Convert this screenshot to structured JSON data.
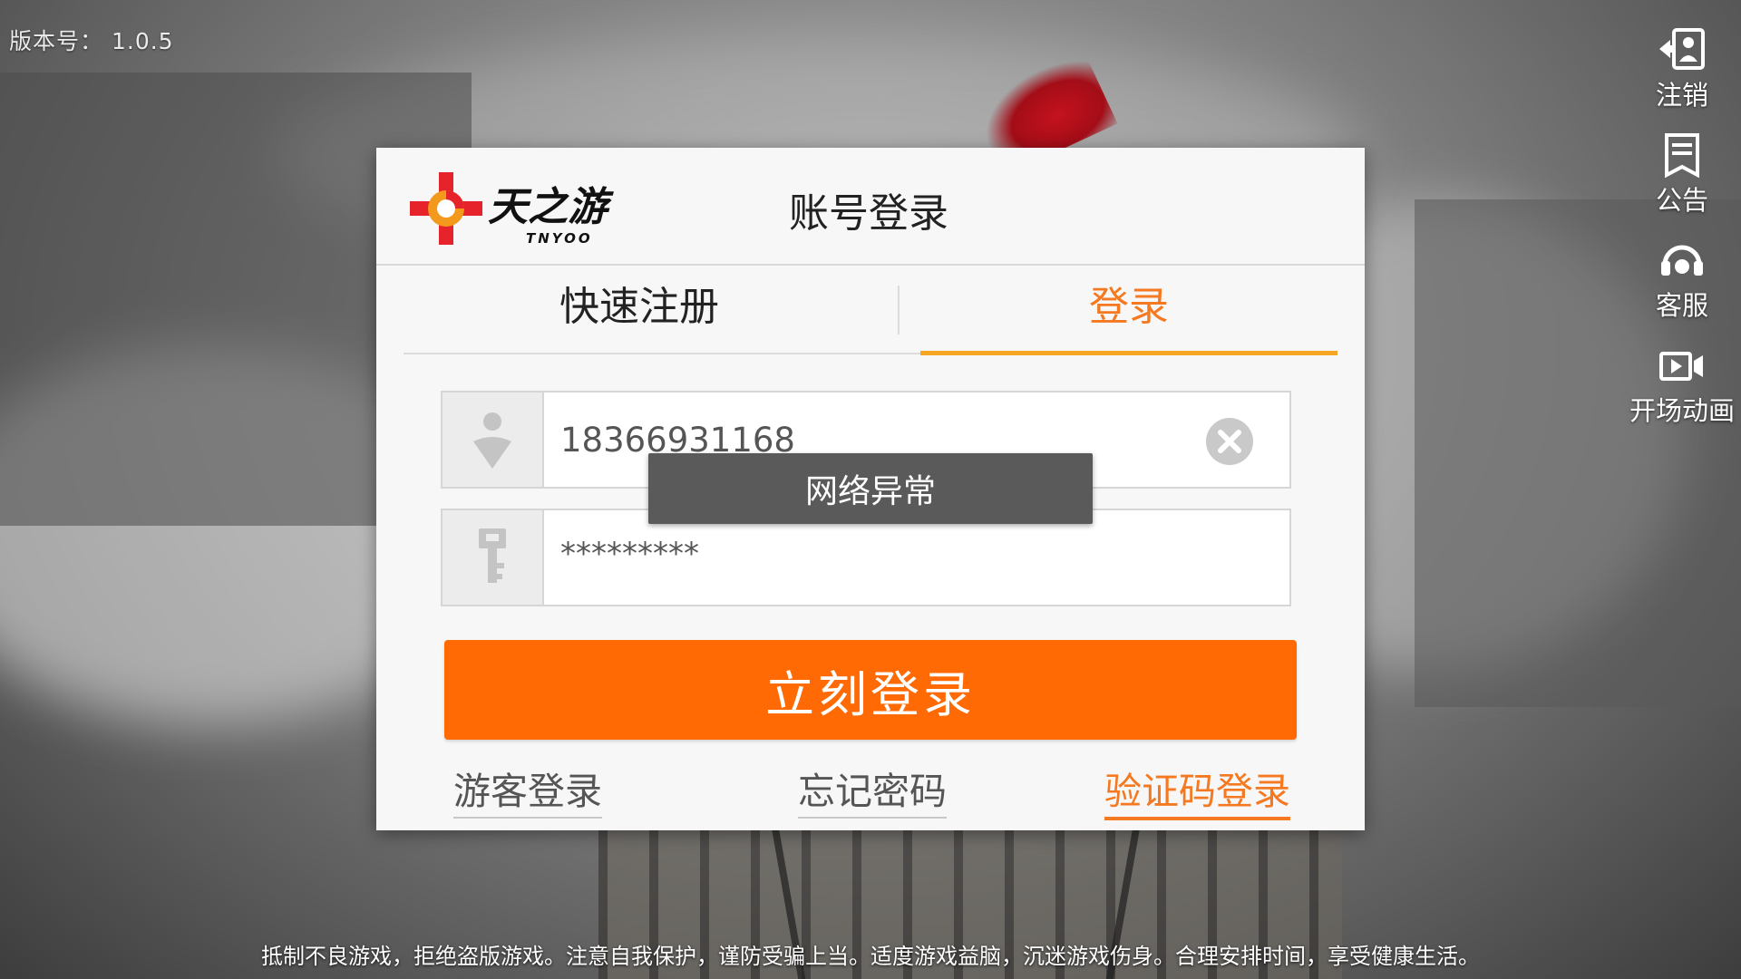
{
  "version": {
    "label": "版本号：",
    "value": "1.0.5"
  },
  "side_menu": [
    {
      "id": "logout",
      "label": "注销",
      "icon": "logout-icon"
    },
    {
      "id": "notice",
      "label": "公告",
      "icon": "notice-icon"
    },
    {
      "id": "service",
      "label": "客服",
      "icon": "headset-icon"
    },
    {
      "id": "intro",
      "label": "开场动画",
      "icon": "video-icon"
    }
  ],
  "dialog": {
    "title": "账号登录",
    "logo": {
      "cn": "天之游",
      "en": "TNYOO"
    },
    "tabs": {
      "register": "快速注册",
      "login": "登录",
      "active": "login"
    },
    "username": {
      "value": "18366931168",
      "icon": "user-icon"
    },
    "password": {
      "value": "*********",
      "icon": "key-icon"
    },
    "toast": "网络异常",
    "login_button": "立刻登录",
    "links": {
      "guest": "游客登录",
      "forgot": "忘记密码",
      "sms": "验证码登录"
    }
  },
  "footer": "抵制不良游戏，拒绝盗版游戏。注意自我保护，谨防受骗上当。适度游戏益脑，沉迷游戏伤身。合理安排时间，享受健康生活。",
  "colors": {
    "accent": "#ff6a04",
    "tab_active": "#f47920",
    "tab_underline": "#f6a623",
    "toast_bg": "#5a5a5a"
  }
}
